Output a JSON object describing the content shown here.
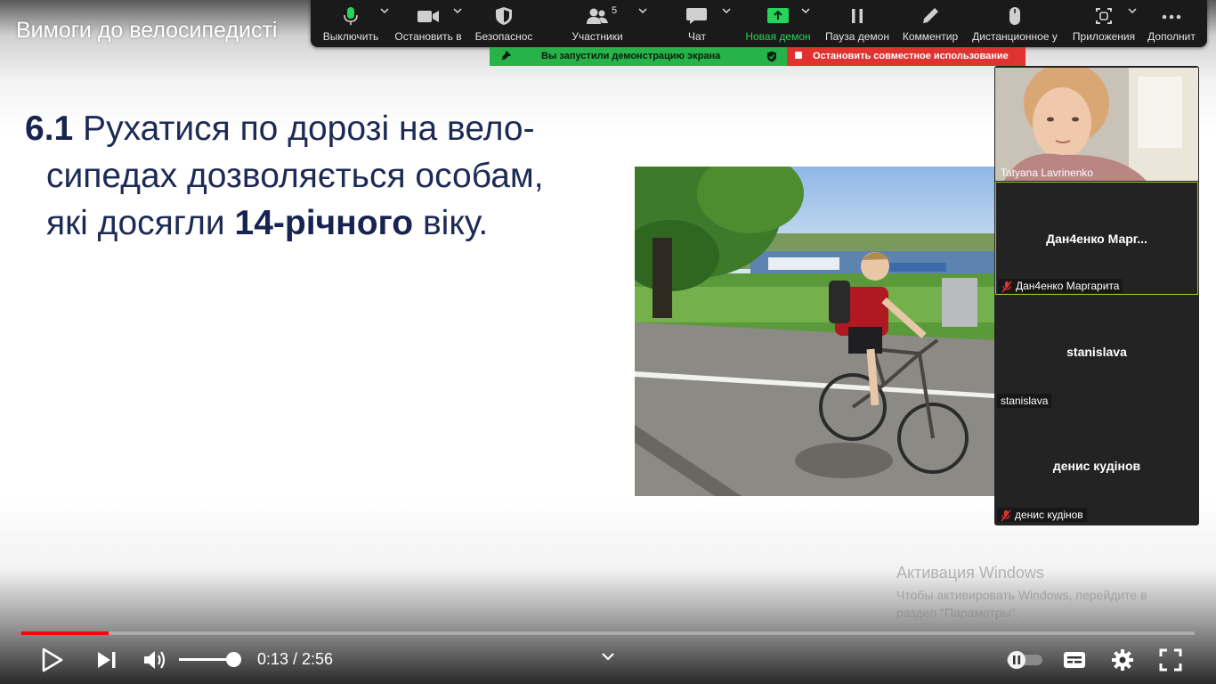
{
  "video": {
    "title": "Вимоги до велосипедисті"
  },
  "slide": {
    "num": "6.1",
    "line1_rest": " Рухатися по дорозі на вело-",
    "line2": "сипедах дозволяється особам,",
    "line3_pre": "які досягли ",
    "line3_bold": "14-річного",
    "line3_post": " віку."
  },
  "zoom_toolbar": {
    "mute_label": "Выключить",
    "video_label": "Остановить в",
    "security_label": "Безопаснос",
    "participants_label": "Участники",
    "participants_count": "5",
    "chat_label": "Чат",
    "new_share_label": "Новая демон",
    "pause_share_label": "Пауза демон",
    "annotate_label": "Комментир",
    "remote_control_label": "Дистанционное у",
    "apps_label": "Приложения",
    "more_label": "Дополнит"
  },
  "share_banner": {
    "status": "Вы запустили демонстрацию экрана",
    "stop": "Остановить совместное использование"
  },
  "participants": [
    {
      "name": "Tatyana Lavrinenko",
      "display": "",
      "muted": false,
      "video": true
    },
    {
      "name": "Дан4енко Маргарита",
      "display": "Дан4енко  Марг...",
      "muted": true,
      "active": true
    },
    {
      "name": "stanislava",
      "display": "stanislava",
      "muted": false
    },
    {
      "name": "денис кудінов",
      "display": "денис кудінов",
      "muted": true
    }
  ],
  "watermark": {
    "title": "Активация Windows",
    "body": "Чтобы активировать Windows, перейдите в раздел \"Параметры\"."
  },
  "player": {
    "time": "0:13 / 2:56",
    "progress_fraction": 0.074,
    "volume_fraction": 0.9,
    "icons": [
      "play-icon",
      "next-icon",
      "volume-icon",
      "chevron-down-icon",
      "autoplay-toggle",
      "subtitles-icon",
      "settings-gear-icon",
      "fullscreen-icon"
    ]
  },
  "colors": {
    "slide_text": "#1c2a55",
    "progress": "#ff0000",
    "share_green": "#27b34a",
    "share_red": "#e0322f",
    "zoom_green": "#25d45a",
    "active_tile_border": "#9ccc2b"
  }
}
